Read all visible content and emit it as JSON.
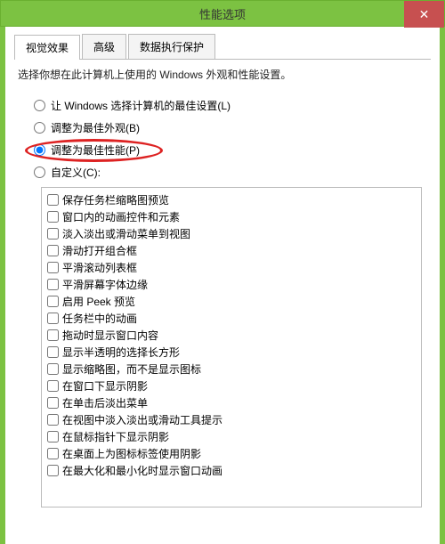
{
  "titlebar": {
    "title": "性能选项",
    "close": "✕"
  },
  "tabs": [
    {
      "label": "视觉效果",
      "active": true
    },
    {
      "label": "高级",
      "active": false
    },
    {
      "label": "数据执行保护",
      "active": false
    }
  ],
  "description": "选择你想在此计算机上使用的 Windows 外观和性能设置。",
  "radios": [
    {
      "label": "让 Windows 选择计算机的最佳设置(L)",
      "checked": false,
      "highlight": false
    },
    {
      "label": "调整为最佳外观(B)",
      "checked": false,
      "highlight": false
    },
    {
      "label": "调整为最佳性能(P)",
      "checked": true,
      "highlight": true
    },
    {
      "label": "自定义(C):",
      "checked": false,
      "highlight": false
    }
  ],
  "checkboxes": [
    {
      "label": "保存任务栏缩略图预览",
      "checked": false
    },
    {
      "label": "窗口内的动画控件和元素",
      "checked": false
    },
    {
      "label": "淡入淡出或滑动菜单到视图",
      "checked": false
    },
    {
      "label": "滑动打开组合框",
      "checked": false
    },
    {
      "label": "平滑滚动列表框",
      "checked": false
    },
    {
      "label": "平滑屏幕字体边缘",
      "checked": false
    },
    {
      "label": "启用 Peek 预览",
      "checked": false
    },
    {
      "label": "任务栏中的动画",
      "checked": false
    },
    {
      "label": "拖动时显示窗口内容",
      "checked": false
    },
    {
      "label": "显示半透明的选择长方形",
      "checked": false
    },
    {
      "label": "显示缩略图，而不是显示图标",
      "checked": false
    },
    {
      "label": "在窗口下显示阴影",
      "checked": false
    },
    {
      "label": "在单击后淡出菜单",
      "checked": false
    },
    {
      "label": "在视图中淡入淡出或滑动工具提示",
      "checked": false
    },
    {
      "label": "在鼠标指针下显示阴影",
      "checked": false
    },
    {
      "label": "在桌面上为图标标签使用阴影",
      "checked": false
    },
    {
      "label": "在最大化和最小化时显示窗口动画",
      "checked": false
    }
  ]
}
